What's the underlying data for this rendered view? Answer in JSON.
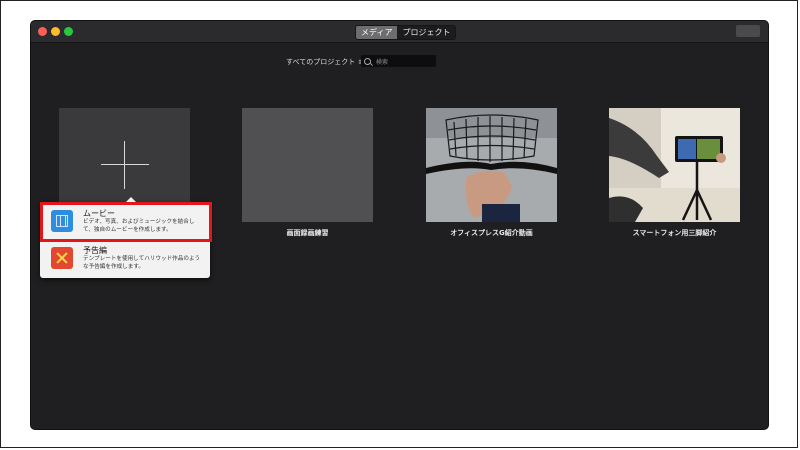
{
  "toolbar": {
    "tabs": [
      {
        "label": "メディア",
        "active": true
      },
      {
        "label": "プロジェクト",
        "active": false
      }
    ]
  },
  "filter": {
    "label": "すべてのプロジェクト"
  },
  "search": {
    "placeholder": "検索"
  },
  "projects": [
    {
      "title": ""
    },
    {
      "title": "画面録画練習"
    },
    {
      "title": "オフィスプレスG紹介動画"
    },
    {
      "title": "スマートフォン用三脚紹介"
    }
  ],
  "new_menu": {
    "items": [
      {
        "title": "ムービー",
        "description": "ビデオ、写真、およびミュージックを結合して、独自のムービーを作成します。",
        "icon": "film-icon"
      },
      {
        "title": "予告編",
        "description": "テンプレートを使用してハリウッド作品のような予告編を作成します。",
        "icon": "trailer-icon"
      }
    ]
  },
  "colors": {
    "highlight": "#e2161b",
    "window_bg": "#1f1f21"
  }
}
